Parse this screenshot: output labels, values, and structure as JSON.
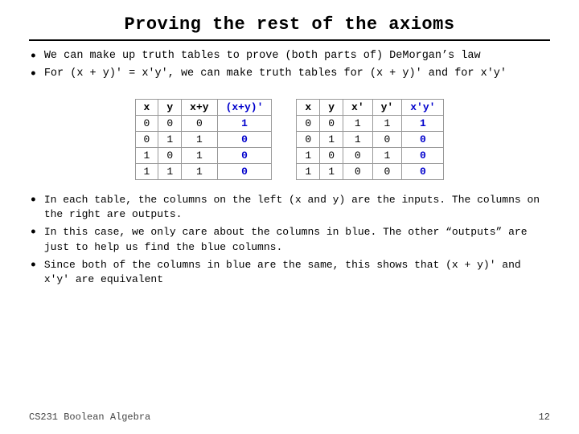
{
  "title": "Proving the rest of the axioms",
  "bullets_top": [
    "We can make up truth tables to prove (both parts of) De​Morgan’s law",
    "For (x + y)’ = x’y’, we can make truth tables for (x + y)’ and for x’y’"
  ],
  "table_left": {
    "headers": [
      "x",
      "y",
      "x+y",
      "(x+y)'"
    ],
    "blue_col": 3,
    "rows": [
      [
        "0",
        "0",
        "0",
        "1"
      ],
      [
        "0",
        "1",
        "1",
        "0"
      ],
      [
        "1",
        "0",
        "1",
        "0"
      ],
      [
        "1",
        "1",
        "1",
        "0"
      ]
    ]
  },
  "table_right": {
    "headers": [
      "x",
      "y",
      "x'",
      "y'",
      "x'y'"
    ],
    "blue_col": 4,
    "rows": [
      [
        "0",
        "0",
        "1",
        "1",
        "1"
      ],
      [
        "0",
        "1",
        "1",
        "0",
        "0"
      ],
      [
        "1",
        "0",
        "0",
        "1",
        "0"
      ],
      [
        "1",
        "1",
        "0",
        "0",
        "0"
      ]
    ]
  },
  "bullets_bottom": [
    "In each table, the columns on the left (x and y) are the inputs. The columns on the right are outputs.",
    "In this case, we only care about the columns in blue. The other “outputs” are just to help us find the blue columns.",
    "Since both of the columns in blue are the same, this shows that (x + y)’ and x’y’ are equivalent"
  ],
  "footer": {
    "left": "CS231 Boolean Algebra",
    "right": "12"
  }
}
